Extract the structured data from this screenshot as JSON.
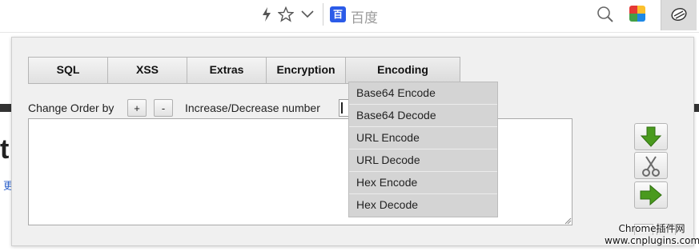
{
  "browser": {
    "search_placeholder": "百度",
    "search_engine_logo_text": "百"
  },
  "page_behind": {
    "heading_fragment": "t",
    "link_fragment": "更"
  },
  "tabs": [
    {
      "label": "SQL"
    },
    {
      "label": "XSS"
    },
    {
      "label": "Extras"
    },
    {
      "label": "Encryption"
    },
    {
      "label": "Encoding",
      "active": true
    }
  ],
  "controls": {
    "change_order_label": "Change Order by",
    "plus_label": "+",
    "minus_label": "-",
    "incdec_label": "Increase/Decrease number"
  },
  "encoding_menu": [
    {
      "label": "Base64 Encode"
    },
    {
      "label": "Base64 Decode"
    },
    {
      "label": "URL Encode"
    },
    {
      "label": "URL Decode"
    },
    {
      "label": "Hex Encode"
    },
    {
      "label": "Hex Decode"
    }
  ],
  "actions": {
    "icons": [
      "arrow-down-icon",
      "scissors-icon",
      "arrow-right-icon"
    ]
  },
  "watermark": {
    "line1": "Chrome插件网",
    "line2": "www.cnplugins.com"
  },
  "colors": {
    "accent_green": "#4a9a1e",
    "popup_bg": "#f0f0f0",
    "dropdown_bg": "#d4d4d4"
  }
}
